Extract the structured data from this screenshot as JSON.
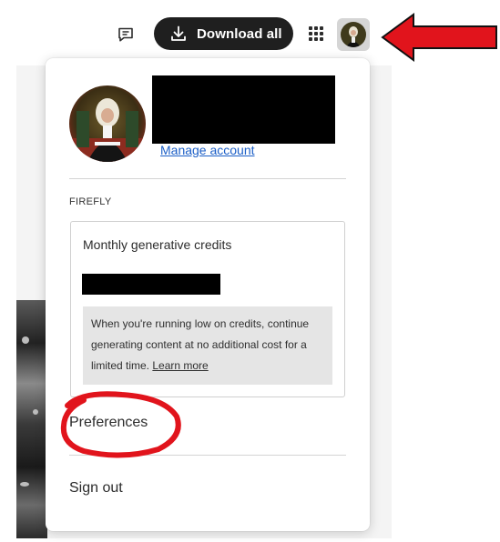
{
  "header": {
    "download_label": "Download all",
    "icons": {
      "feedback": "message-icon",
      "download": "download-icon",
      "apps": "apps-grid-icon",
      "avatar": "user-avatar"
    }
  },
  "menu": {
    "manage_account_label": "Manage account",
    "section_label": "FIREFLY",
    "credits": {
      "title": "Monthly generative credits",
      "note_text": "When you're running low on credits, continue generating content at no additional cost for a limited time. ",
      "learn_more_label": "Learn more"
    },
    "items": [
      {
        "label": "Preferences"
      },
      {
        "label": "Sign out"
      }
    ]
  },
  "colors": {
    "button_dark": "#1f1f1f",
    "link_blue": "#1c5fc7",
    "annotation_red": "#e1141c"
  }
}
